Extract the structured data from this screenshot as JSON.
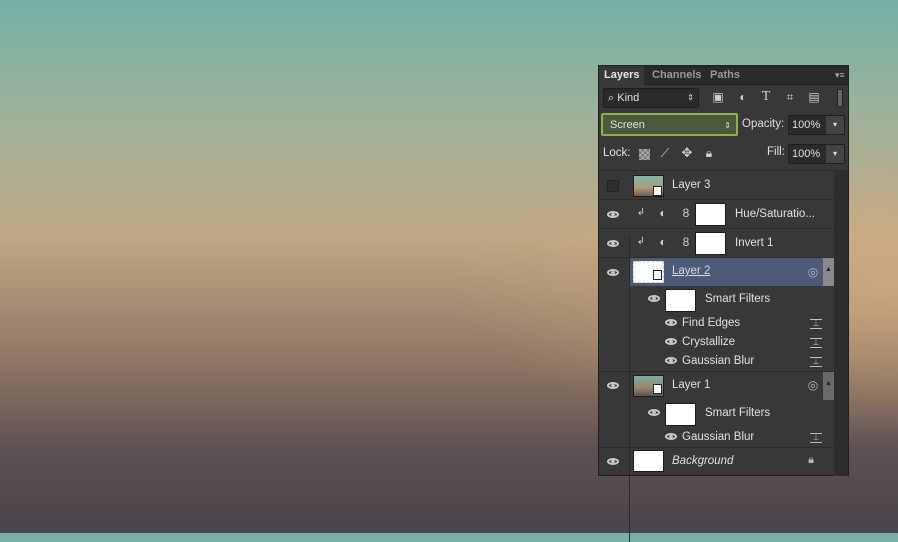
{
  "panel": {
    "tabs": [
      {
        "label": "Layers",
        "active": true
      },
      {
        "label": "Channels"
      },
      {
        "label": "Paths"
      }
    ],
    "filter": {
      "kind_label": "Kind"
    },
    "blend_mode": "Screen",
    "opacity_label": "Opacity:",
    "opacity_value": "100%",
    "lock_label": "Lock:",
    "fill_label": "Fill:",
    "fill_value": "100%",
    "layers": [
      {
        "name": "Layer 3",
        "visible": false
      },
      {
        "name": "Hue/Saturatio...",
        "visible": true,
        "type": "adjustment"
      },
      {
        "name": "Invert 1",
        "visible": true,
        "type": "adjustment"
      },
      {
        "name": "Layer 2",
        "visible": true,
        "selected": true,
        "smart_filters_label": "Smart Filters",
        "filters": [
          "Find Edges",
          "Crystallize",
          "Gaussian Blur"
        ]
      },
      {
        "name": "Layer 1",
        "visible": true,
        "smart_filters_label": "Smart Filters",
        "filters": [
          "Gaussian Blur"
        ]
      },
      {
        "name": "Background",
        "visible": true,
        "locked": true
      }
    ]
  },
  "colors": {
    "selected_row": "#4d5a78",
    "blend_highlight": "#8fb04a"
  }
}
